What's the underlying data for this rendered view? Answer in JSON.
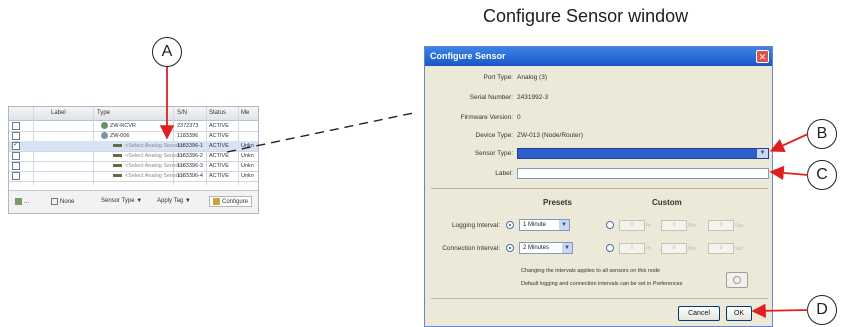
{
  "figure": {
    "title": "Configure Sensor window"
  },
  "callouts": {
    "a": "A",
    "b": "B",
    "c": "C",
    "d": "D"
  },
  "table": {
    "headers": {
      "label": "Label",
      "type": "Type",
      "sn": "S/N",
      "status": "Status",
      "more": "Me"
    },
    "rows": [
      {
        "type": "ZW-RCVR",
        "sn": "2372373",
        "status": "ACTIVE",
        "more": ""
      },
      {
        "type": "ZW-006",
        "sn": "1183396",
        "status": "ACTIVE",
        "more": ""
      },
      {
        "type": "<Select Analog Sensor>",
        "sn": "1183396-1",
        "status": "ACTIVE",
        "more": "Unkn"
      },
      {
        "type": "<Select Analog Sensor>",
        "sn": "1183396-2",
        "status": "ACTIVE",
        "more": "Unkn"
      },
      {
        "type": "<Select Analog Sensor>",
        "sn": "1183396-3",
        "status": "ACTIVE",
        "more": "Unkn"
      },
      {
        "type": "<Select Analog Sensor>",
        "sn": "1183396-4",
        "status": "ACTIVE",
        "more": "Unkn"
      }
    ],
    "toolbar": {
      "all": "...",
      "none": "None",
      "sensor_type": "Sensor Type ▼",
      "apply_tag": "Apply Tag ▼",
      "configure": "Configure"
    }
  },
  "dialog": {
    "title": "Configure Sensor",
    "port_type_label": "Port Type:",
    "port_type_value": "Analog (3)",
    "serial_label": "Serial Number:",
    "serial_value": "2431992-3",
    "firmware_label": "Firmware Version:",
    "firmware_value": "0",
    "device_type_label": "Device Type:",
    "device_type_value": "ZW-013 (Node/Router)",
    "sensor_type_label": "Sensor Type:",
    "label_label": "Label:",
    "presets_heading": "Presets",
    "custom_heading": "Custom",
    "logging_label": "Logging Interval:",
    "logging_value": "1 Minute",
    "connection_label": "Connection Interval:",
    "connection_value": "2 Minutes",
    "spin_value": "0",
    "unit_hr": "Hr",
    "unit_min": "Min",
    "unit_sec": "Sec",
    "note1": "Changing the intervals applies to all sensors on this node",
    "note2": "Default logging and connection intervals can be set in Preferences",
    "cancel": "Cancel",
    "ok": "OK"
  },
  "colors": {
    "titlebar": "#1857c9",
    "dialog_bg": "#ece9d8",
    "arrow": "#e02020",
    "selected_field": "#2f5fcf"
  }
}
